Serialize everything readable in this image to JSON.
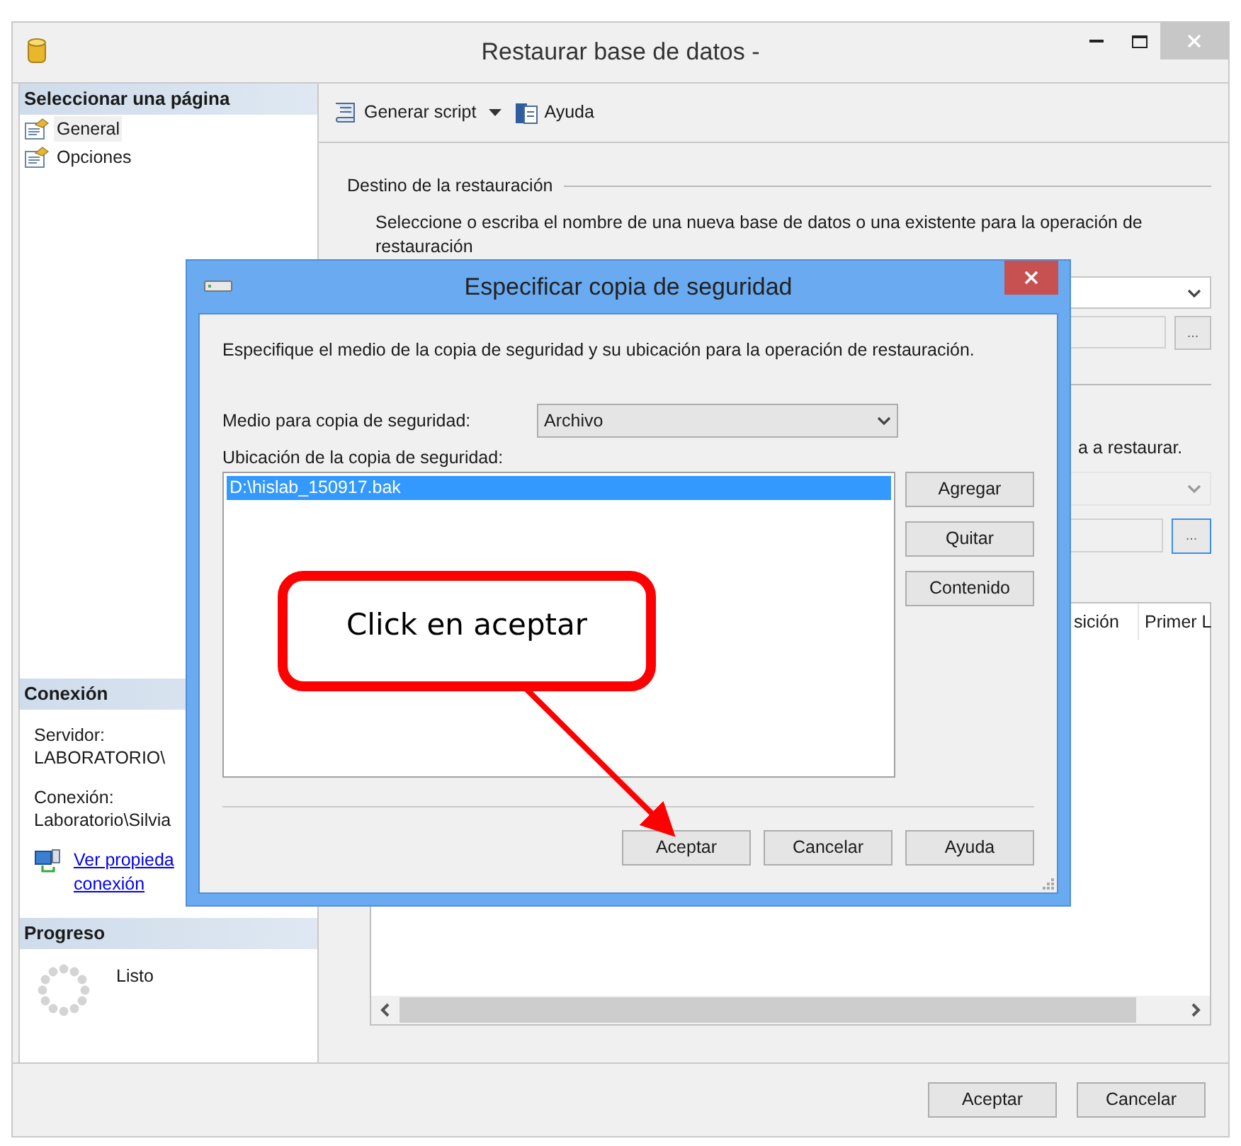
{
  "window": {
    "title": "Restaurar base de datos -"
  },
  "sidebar": {
    "header": "Seleccionar una página",
    "items": [
      {
        "label": "General",
        "selected": true
      },
      {
        "label": "Opciones",
        "selected": false
      }
    ]
  },
  "connection": {
    "header": "Conexión",
    "server_label": "Servidor:",
    "server_value": "LABORATORIO\\",
    "connection_label": "Conexión:",
    "connection_value": "Laboratorio\\Silvia",
    "link_lines": [
      "Ver propieda",
      "conexión"
    ]
  },
  "progress": {
    "header": "Progreso",
    "status": "Listo"
  },
  "toolbar": [
    {
      "label": "Generar script",
      "kind": "script"
    },
    {
      "label": "Ayuda",
      "kind": "help"
    }
  ],
  "destination": {
    "title": "Destino de la restauración",
    "description": "Seleccione o escriba el nombre de una nueva base de datos o una existente para la operación de restauración"
  },
  "source": {
    "description_tail": "a a restaurar.",
    "browse_buttons": [
      "...",
      "..."
    ]
  },
  "table": {
    "columns": [
      "sición",
      "Primer L"
    ]
  },
  "buttons": [
    "Aceptar",
    "Cancelar"
  ],
  "dialog": {
    "title": "Especificar copia de seguridad",
    "intro": "Especifique el medio de la copia de seguridad y su ubicación para la operación de restauración.",
    "media_label": "Medio para copia de seguridad:",
    "media_value": "Archivo",
    "location_label": "Ubicación de la copia de seguridad:",
    "locations": [
      {
        "path": "D:\\hislab_150917.bak",
        "selected": true
      }
    ],
    "side_buttons": [
      "Agregar",
      "Quitar",
      "Contenido"
    ],
    "buttons": [
      "Aceptar",
      "Cancelar",
      "Ayuda"
    ]
  },
  "callout": {
    "text": "Click en aceptar"
  }
}
